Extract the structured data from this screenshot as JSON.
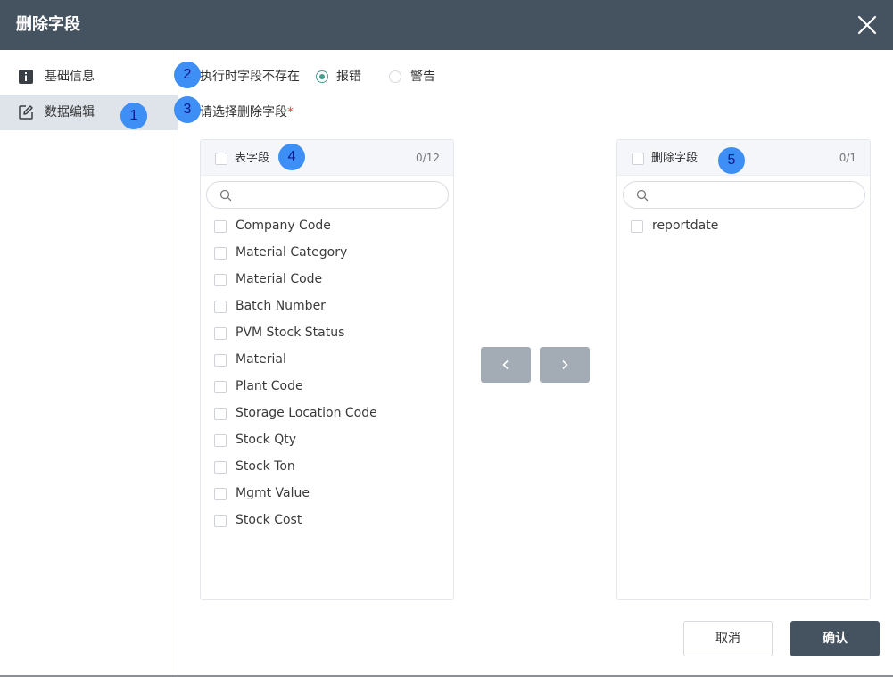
{
  "dialog": {
    "title": "删除字段"
  },
  "sidebar": {
    "items": [
      {
        "label": "基础信息",
        "icon": "info-icon",
        "active": false
      },
      {
        "label": "数据编辑",
        "icon": "edit-icon",
        "active": true
      }
    ]
  },
  "badges": [
    "1",
    "2",
    "3",
    "4",
    "5"
  ],
  "options": {
    "missing_field_label": "执行时字段不存在",
    "radio_error": "报错",
    "radio_warning": "警告",
    "selected": "报错",
    "select_fields_label": "请选择删除字段",
    "required_mark": "*"
  },
  "left_panel": {
    "title": "表字段",
    "count": "0/12",
    "search_placeholder": "",
    "items": [
      "Company Code",
      "Material Category",
      "Material Code",
      "Batch Number",
      "PVM Stock Status",
      "Material",
      "Plant Code",
      "Storage Location Code",
      "Stock Qty",
      "Stock Ton",
      "Mgmt Value",
      "Stock Cost"
    ]
  },
  "right_panel": {
    "title": "删除字段",
    "count": "0/1",
    "search_placeholder": "",
    "items": [
      "reportdate"
    ]
  },
  "transfer": {
    "left_icon": "chevron-left-icon",
    "right_icon": "chevron-right-icon"
  },
  "footer": {
    "cancel_label": "取消",
    "confirm_label": "确认"
  },
  "colors": {
    "header": "#455260",
    "accent": "#4a9c8e",
    "badge": "#3d8ff5",
    "transfer_button": "#a3acb5"
  }
}
